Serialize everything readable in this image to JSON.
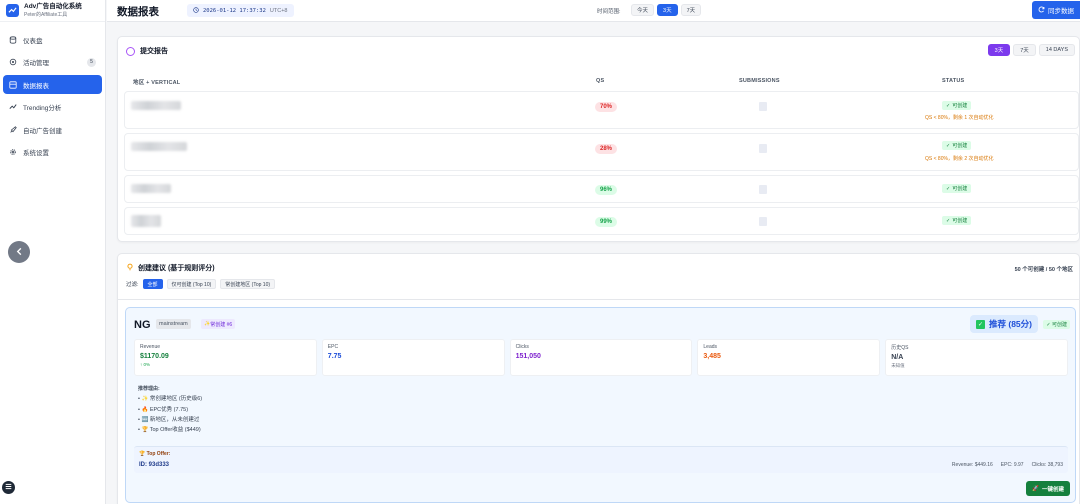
{
  "brand": {
    "title": "Adv广告自动化系统",
    "subtitle": "Peter的Affiliate工具"
  },
  "sidebar": {
    "items": [
      {
        "label": "仪表盘",
        "icon": "database-icon"
      },
      {
        "label": "活动管理",
        "icon": "gear-icon",
        "badge": "5"
      },
      {
        "label": "数据报表",
        "icon": "chart-icon"
      },
      {
        "label": "Trending分析",
        "icon": "trending-icon"
      },
      {
        "label": "自动广告创建",
        "icon": "rocket-icon"
      },
      {
        "label": "系统设置",
        "icon": "settings-icon"
      }
    ]
  },
  "header": {
    "title": "数据报表",
    "datetime": "2026-01-12 17:37:32",
    "timezone": "UTC+8",
    "range_label": "时间范围:",
    "ranges": [
      "今天",
      "3天",
      "7天"
    ],
    "sync_label": "同步数据"
  },
  "report": {
    "title": "提交报告",
    "day_buttons": [
      "3天",
      "7天",
      "14 DAYS"
    ],
    "columns": [
      "地区 + VERTICAL",
      "QS",
      "SUBMISSIONS",
      "STATUS"
    ],
    "rows": [
      {
        "qs": "70%",
        "status": "可创建",
        "note": "QS < 80%，剩余 1 次自动优化"
      },
      {
        "qs": "28%",
        "status": "可创建",
        "note": "QS < 80%，剩余 2 次自动优化"
      },
      {
        "qs": "96%",
        "status": "可创建",
        "note": ""
      },
      {
        "qs": "99%",
        "status": "可创建",
        "note": ""
      }
    ]
  },
  "suggestion": {
    "title": "创建建议 (基于规则评分)",
    "count_text": "50 个可创建 / 50 个地区",
    "filter_label": "过滤:",
    "filters": [
      "全部",
      "仅可创建 (Top 10)",
      "常创建地区 (Top 10)"
    ],
    "geo": {
      "code": "NG",
      "tag": "mainstream",
      "rank": "常创建 #6",
      "recommend": "推荐 (85分)",
      "can_create": "✓ 可创建",
      "metrics": [
        {
          "label": "Revenue",
          "value": "$1170.09",
          "sub": "↑ 0%",
          "color": "#15803d"
        },
        {
          "label": "EPC",
          "value": "7.75",
          "sub": "",
          "color": "#1d4ed8"
        },
        {
          "label": "Clicks",
          "value": "151,050",
          "sub": "",
          "color": "#7e22ce"
        },
        {
          "label": "Leads",
          "value": "3,485",
          "sub": "",
          "color": "#ea580c"
        },
        {
          "label": "历史QS",
          "value": "N/A",
          "sub": "未知值",
          "color": "#374151"
        }
      ],
      "reasons_header": "推荐理由:",
      "reasons": [
        "• ✨ 常创建地区 (历史级6)",
        "• 🔥 EPC优秀 (7.75)",
        "• 🆕 新地区，从未创建过",
        "• 🏆 Top Offer收益 ($449)"
      ],
      "offer": {
        "header": "Top Offer:",
        "id": "ID: 93d333",
        "revenue": "Revenue: $449.16",
        "epc": "EPC: 9.97",
        "clicks": "Clicks: 38,793"
      },
      "create_label": "一键创建"
    }
  }
}
